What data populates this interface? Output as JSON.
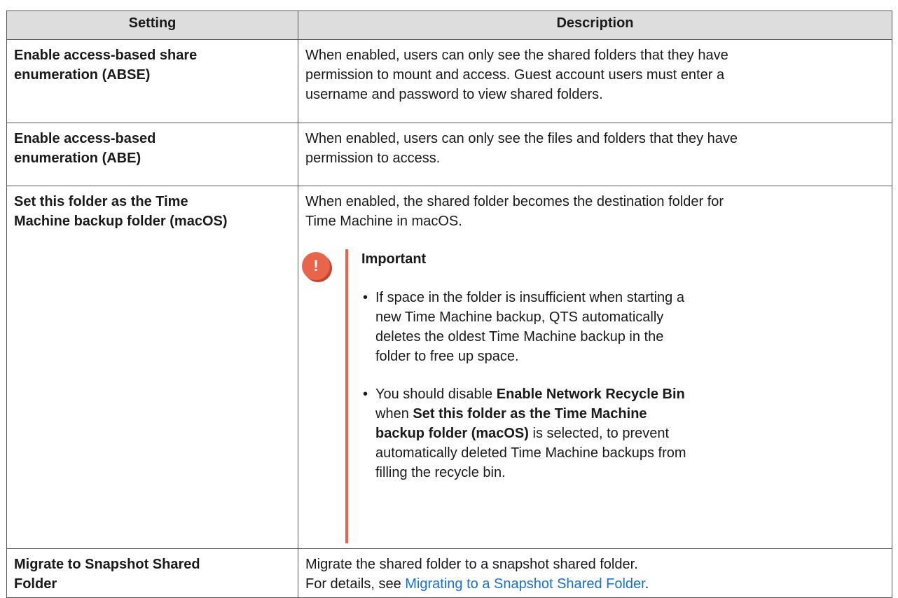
{
  "table": {
    "header": {
      "setting": "Setting",
      "description": "Description"
    },
    "rows": [
      {
        "setting_lines": [
          "Enable access-based share",
          "enumeration (ABSE)"
        ],
        "desc_lines": [
          "When enabled, users can only see the shared folders that they have",
          "permission to mount and access. Guest account users must enter a",
          "username and password to view shared folders."
        ]
      },
      {
        "setting_lines": [
          "Enable access-based",
          "enumeration (ABE)"
        ],
        "desc_lines": [
          "When enabled, users can only see the files and folders that they have",
          "permission to access."
        ]
      },
      {
        "setting_lines": [
          "Set this folder as the Time",
          "Machine backup folder (macOS)"
        ],
        "desc_lines": [
          "When enabled, the shared folder becomes the destination folder for",
          "Time Machine in macOS."
        ],
        "note": {
          "icon_glyph": "!",
          "icon_name": "important-icon",
          "accent_color": "#e8644a",
          "title": "Important",
          "bullet": "•",
          "item1_lines": [
            "If space in the folder is insufficient when starting a",
            "new Time Machine backup, QTS automatically",
            "deletes the oldest Time Machine backup in the",
            "folder to free up space."
          ],
          "item2": {
            "l1_pre": "You should disable ",
            "l1_bold": "Enable Network Recycle Bin",
            "l2_pre": "when ",
            "l2_bold": "Set this folder as the Time Machine",
            "l3_bold": "backup folder (macOS)",
            "l3_post": " is selected, to prevent",
            "l4": "automatically deleted Time Machine backups from",
            "l5": "filling the recycle bin."
          }
        }
      },
      {
        "setting_lines": [
          "Migrate to Snapshot Shared",
          "Folder"
        ],
        "desc_lines": [
          "Migrate the shared folder to a snapshot shared folder."
        ],
        "desc_link_pre": "For details, see ",
        "desc_link": "Migrating to a Snapshot Shared Folder",
        "desc_link_post": ".",
        "link_color": "#1a6fd6"
      }
    ]
  }
}
